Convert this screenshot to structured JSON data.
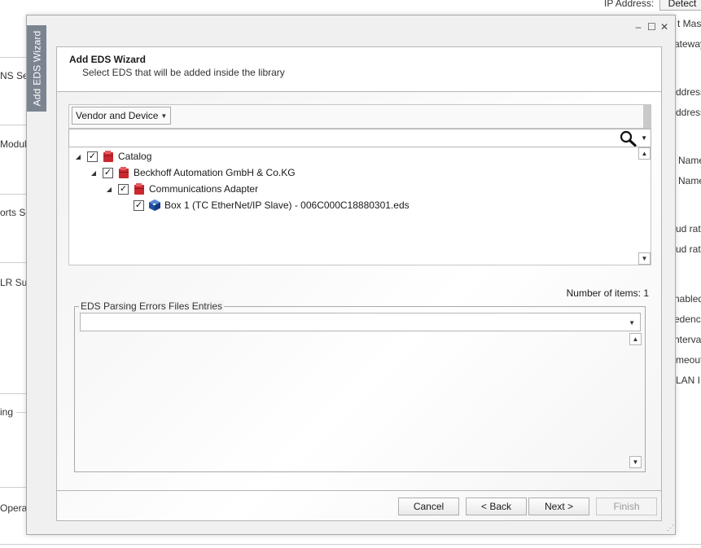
{
  "background": {
    "top_label": "IP Address:",
    "detect_button": "Detect",
    "left_fragments": [
      "NS Se",
      "Module",
      "orts Se",
      "LR Su",
      "ing",
      "Operati"
    ],
    "right_fragments": [
      "t Mask",
      "ateway",
      "ddress",
      "ddress",
      "Name",
      "Name",
      "ud rate",
      "ud rate",
      "nabled",
      "edence",
      "nterval",
      "meout",
      "LAN ID"
    ]
  },
  "dialog": {
    "side_tab": "Add EDS Wizard",
    "window_controls": {
      "minimize": "–",
      "maximize": "☐",
      "close": "✕"
    },
    "header": {
      "title": "Add EDS Wizard",
      "subtitle": "Select EDS that will be added inside the library"
    },
    "filter": {
      "view_mode": "Vendor and Device"
    },
    "search": {
      "value": "",
      "placeholder": ""
    },
    "tree": [
      {
        "label": "Catalog",
        "checked": true,
        "expanded": true,
        "icon": "folder-red-icon"
      },
      {
        "label": "Beckhoff Automation GmbH & Co.KG",
        "checked": true,
        "expanded": true,
        "icon": "folder-red-icon"
      },
      {
        "label": "Communications Adapter",
        "checked": true,
        "expanded": true,
        "icon": "folder-red-icon"
      },
      {
        "label": "Box 1 (TC EtherNet/IP Slave) - 006C000C18880301.eds",
        "checked": true,
        "expanded": null,
        "icon": "device-cube-icon"
      }
    ],
    "items_count": "Number of items: 1",
    "errors_group": {
      "legend": "EDS Parsing Errors Files Entries",
      "value": ""
    },
    "buttons": {
      "cancel": "Cancel",
      "back": "< Back",
      "next": "Next >",
      "finish": "Finish"
    },
    "colors": {
      "side_tab": "#7b8591",
      "folder_red": "#c8282e",
      "device_blue": "#1f4fa0"
    }
  }
}
